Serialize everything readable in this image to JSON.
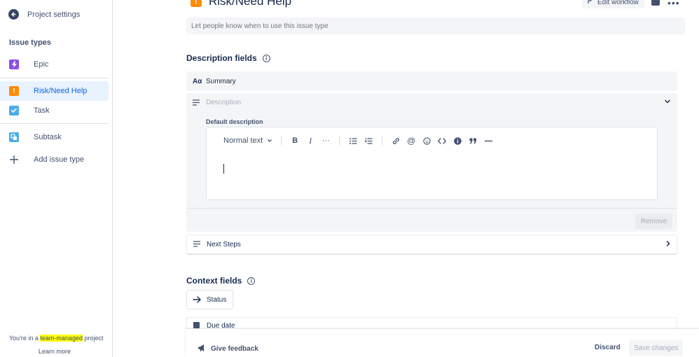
{
  "sidebar": {
    "back_label": "Project settings",
    "section_title": "Issue types",
    "items": [
      {
        "label": "Epic",
        "icon": "lightning-icon",
        "color": "#904EE2"
      },
      {
        "label": "Risk/Need Help",
        "icon": "exclamation-icon",
        "color": "#FF8B00",
        "active": true
      },
      {
        "label": "Task",
        "icon": "checkbox-icon",
        "color": "#4BADE8"
      },
      {
        "label": "Subtask",
        "icon": "subtask-icon",
        "color": "#4BADE8"
      },
      {
        "label": "Add issue type",
        "icon": "plus-icon"
      }
    ],
    "footer_prefix": "You're in a ",
    "footer_highlight": "team-managed",
    "footer_suffix": " project",
    "learn_more": "Learn more"
  },
  "header": {
    "title": "Risk/Need Help",
    "title_icon_glyph": "!",
    "edit_workflow": "Edit workflow"
  },
  "helper": {
    "placeholder": "Let people know when to use this issue type"
  },
  "description_fields": {
    "heading": "Description fields",
    "summary_label": "Summary",
    "summary_icon_glyph": "Aα",
    "description_label": "Description",
    "default_description_label": "Default description",
    "toolbar": {
      "text_style": "Normal text",
      "bold": "B",
      "italic": "I",
      "more": "···"
    },
    "remove_label": "Remove",
    "next_steps_label": "Next Steps"
  },
  "context_fields": {
    "heading": "Context fields",
    "status_label": "Status",
    "due_date_label": "Due date"
  },
  "footer": {
    "give_feedback": "Give feedback",
    "discard": "Discard",
    "save_changes": "Save changes"
  },
  "colors": {
    "accent": "#0C66E4",
    "highlight": "#FFFF00"
  }
}
